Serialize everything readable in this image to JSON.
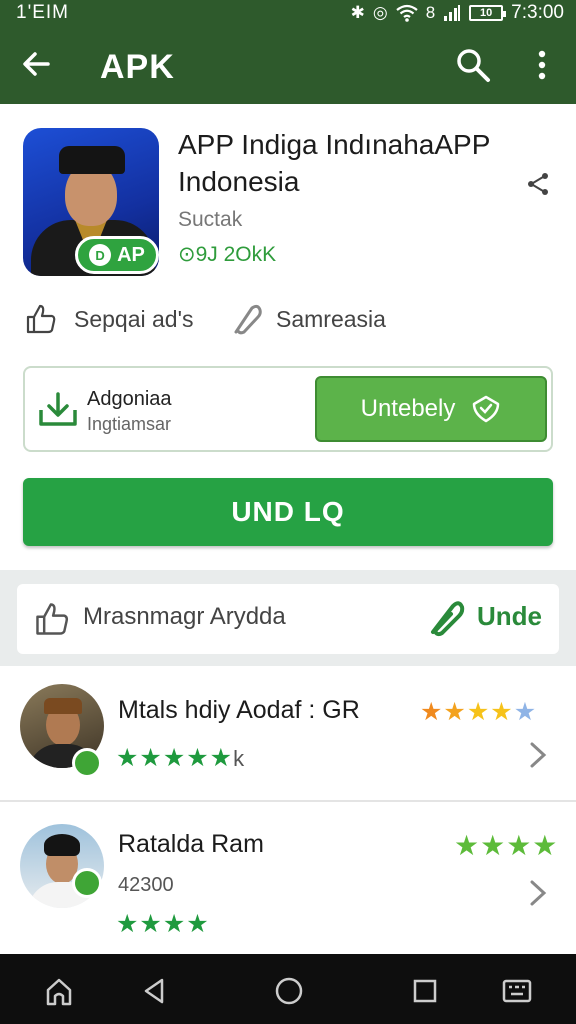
{
  "status_bar": {
    "left_text": "1'EIM",
    "battery": "10",
    "time": "7:3:00"
  },
  "app_bar": {
    "title": "APK"
  },
  "app": {
    "title_line1": "APP Indiga IndınahaAPP",
    "title_line2": "Indonesia",
    "developer": "Suctak",
    "stats": "⊙9J 2OkK",
    "icon_badge": "AP",
    "meta_left": "Sepqai ad's",
    "meta_right": "Samreasia"
  },
  "download_box": {
    "name": "Adgoniaa",
    "subtitle": "Ingtiamsar",
    "button_label": "Untebely"
  },
  "install_button": {
    "label": "UND LQ"
  },
  "rating_bar": {
    "label": "Mrasnmagr Arydda",
    "action": "Unde"
  },
  "reviews": [
    {
      "name": "Mtals hdiy Aodaf : GR",
      "count_suffix": "k",
      "sub": "",
      "top_stars": "★★★★★",
      "bottom_stars": "★★★★"
    },
    {
      "name": "Ratalda Ram",
      "count_suffix": "",
      "sub": "42300",
      "top_stars": "★★★★",
      "bottom_stars": "★★★★"
    }
  ],
  "colors": {
    "header": "#2e5a2c",
    "accent_green": "#26a244",
    "light_green": "#5cb34a",
    "star_orange": "#f08a1e",
    "star_yellow": "#f6c21a",
    "star_blue": "#8fb4e6",
    "star_green": "#1f9a3e"
  }
}
